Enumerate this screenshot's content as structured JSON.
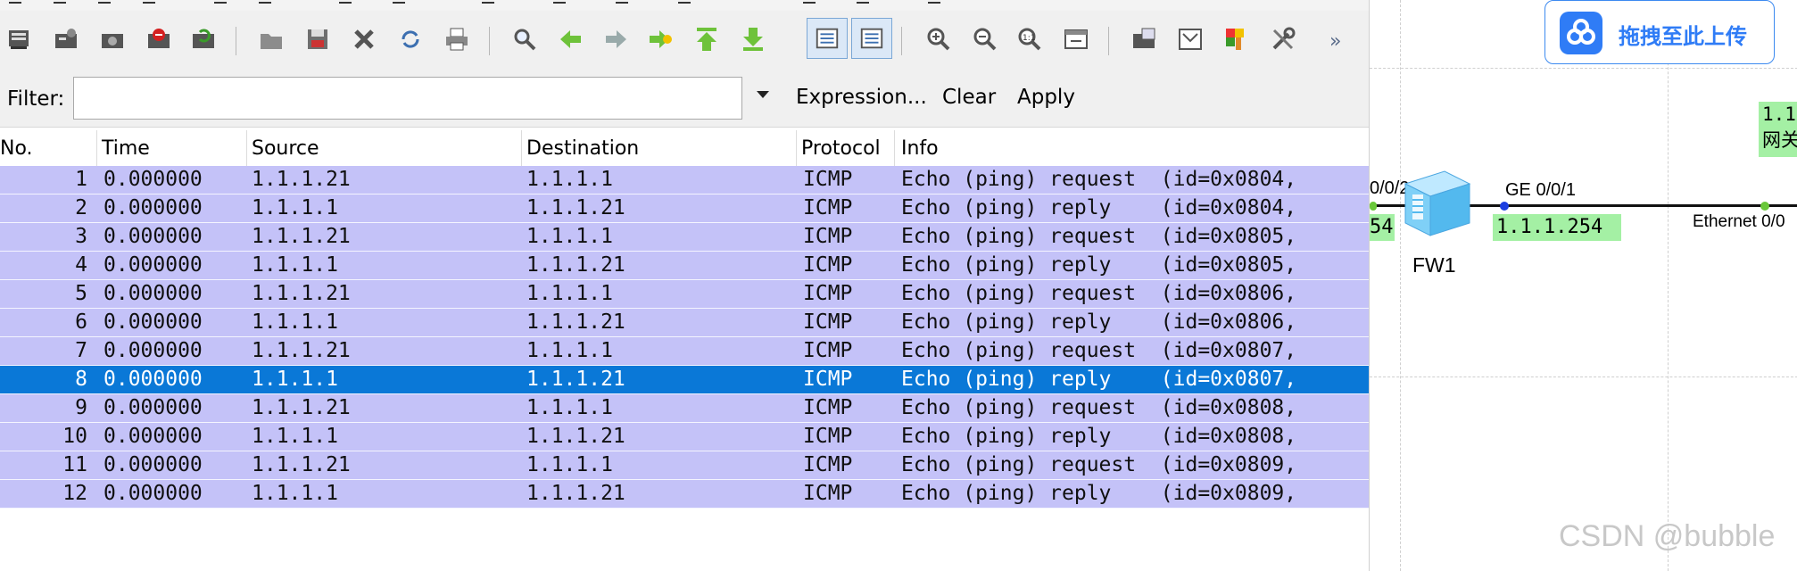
{
  "toolbar": {
    "icons": [
      "interface-list-icon",
      "capture-options-icon",
      "start-capture-icon",
      "stop-capture-icon",
      "restart-capture-icon",
      "open-file-icon",
      "save-file-icon",
      "close-file-icon",
      "reload-icon",
      "print-icon",
      "find-packet-icon",
      "go-back-icon",
      "go-forward-icon",
      "go-to-packet-icon",
      "go-first-icon",
      "go-last-icon",
      "colorize-icon",
      "auto-scroll-icon",
      "zoom-in-icon",
      "zoom-out-icon",
      "normal-size-icon",
      "resize-columns-icon",
      "capture-filters-icon",
      "display-filters-icon",
      "coloring-rules-icon",
      "preferences-icon"
    ],
    "more": "»"
  },
  "filter": {
    "label": "Filter:",
    "value": "",
    "expression": "Expression...",
    "clear": "Clear",
    "apply": "Apply"
  },
  "packet_list": {
    "columns": [
      "No.",
      "Time",
      "Source",
      "Destination",
      "Protocol",
      "Info"
    ],
    "selected_row": 7,
    "rows": [
      {
        "no": "1",
        "time": "0.000000",
        "src": "1.1.1.21",
        "dst": "1.1.1.1",
        "proto": "ICMP",
        "info": "Echo (ping) request  (id=0x0804,"
      },
      {
        "no": "2",
        "time": "0.000000",
        "src": "1.1.1.1",
        "dst": "1.1.1.21",
        "proto": "ICMP",
        "info": "Echo (ping) reply    (id=0x0804,"
      },
      {
        "no": "3",
        "time": "0.000000",
        "src": "1.1.1.21",
        "dst": "1.1.1.1",
        "proto": "ICMP",
        "info": "Echo (ping) request  (id=0x0805,"
      },
      {
        "no": "4",
        "time": "0.000000",
        "src": "1.1.1.1",
        "dst": "1.1.1.21",
        "proto": "ICMP",
        "info": "Echo (ping) reply    (id=0x0805,"
      },
      {
        "no": "5",
        "time": "0.000000",
        "src": "1.1.1.21",
        "dst": "1.1.1.1",
        "proto": "ICMP",
        "info": "Echo (ping) request  (id=0x0806,"
      },
      {
        "no": "6",
        "time": "0.000000",
        "src": "1.1.1.1",
        "dst": "1.1.1.21",
        "proto": "ICMP",
        "info": "Echo (ping) reply    (id=0x0806,"
      },
      {
        "no": "7",
        "time": "0.000000",
        "src": "1.1.1.21",
        "dst": "1.1.1.1",
        "proto": "ICMP",
        "info": "Echo (ping) request  (id=0x0807,"
      },
      {
        "no": "8",
        "time": "0.000000",
        "src": "1.1.1.1",
        "dst": "1.1.1.21",
        "proto": "ICMP",
        "info": "Echo (ping) reply    (id=0x0807,"
      },
      {
        "no": "9",
        "time": "0.000000",
        "src": "1.1.1.21",
        "dst": "1.1.1.1",
        "proto": "ICMP",
        "info": "Echo (ping) request  (id=0x0808,"
      },
      {
        "no": "10",
        "time": "0.000000",
        "src": "1.1.1.1",
        "dst": "1.1.1.21",
        "proto": "ICMP",
        "info": "Echo (ping) reply    (id=0x0808,"
      },
      {
        "no": "11",
        "time": "0.000000",
        "src": "1.1.1.21",
        "dst": "1.1.1.1",
        "proto": "ICMP",
        "info": "Echo (ping) request  (id=0x0809,"
      },
      {
        "no": "12",
        "time": "0.000000",
        "src": "1.1.1.1",
        "dst": "1.1.1.21",
        "proto": "ICMP",
        "info": "Echo (ping) reply    (id=0x0809,"
      }
    ]
  },
  "topology": {
    "upload_button": "拖拽至此上传",
    "left_port_label": "0/0/2",
    "left_ip_label": "54",
    "fw_label": "FW1",
    "ge_port_label": "GE 0/0/1",
    "ge_ip_label": "1.1.1.254",
    "eth_label": "Ethernet 0/0",
    "note_line1": "1.1",
    "note_line2": "网关",
    "watermark": "CSDN @bubble"
  },
  "colors": {
    "row_bg": "#c4c2f8",
    "row_selected_bg": "#0a78d7",
    "link_green": "#a4f0a4",
    "upload_blue": "#2f7cf6"
  }
}
